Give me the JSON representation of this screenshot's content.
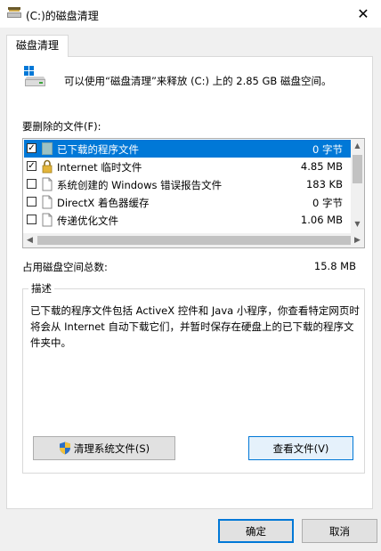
{
  "window": {
    "title": "(C:)的磁盘清理",
    "close_glyph": "✕"
  },
  "tab": {
    "label": "磁盘清理"
  },
  "summary": "可以使用“磁盘清理”来释放  (C:) 上的 2.85 GB 磁盘空间。",
  "files_label": "要删除的文件(F):",
  "files": [
    {
      "name": "已下载的程序文件",
      "size": "0 字节",
      "checked": true,
      "icon": "folder-icon"
    },
    {
      "name": "Internet 临时文件",
      "size": "4.85 MB",
      "checked": true,
      "icon": "lock-icon"
    },
    {
      "name": "系统创建的 Windows 错误报告文件",
      "size": "183 KB",
      "checked": false,
      "icon": "file-icon"
    },
    {
      "name": "DirectX 着色器缓存",
      "size": "0 字节",
      "checked": false,
      "icon": "file-icon"
    },
    {
      "name": "传递优化文件",
      "size": "1.06 MB",
      "checked": false,
      "icon": "file-icon"
    }
  ],
  "total": {
    "label": "占用磁盘空间总数:",
    "value": "15.8 MB"
  },
  "description": {
    "title": "描述",
    "text": "已下载的程序文件包括 ActiveX 控件和 Java 小程序，你查看特定网页时将会从 Internet 自动下载它们，并暂时保存在硬盘上的已下载的程序文件夹中。"
  },
  "buttons": {
    "clean_system": "清理系统文件(S)",
    "view_files": "查看文件(V)",
    "ok": "确定",
    "cancel": "取消"
  },
  "colors": {
    "selection": "#0078d7",
    "button_face": "#e1e1e1",
    "window_bg": "#f0f0f0"
  }
}
